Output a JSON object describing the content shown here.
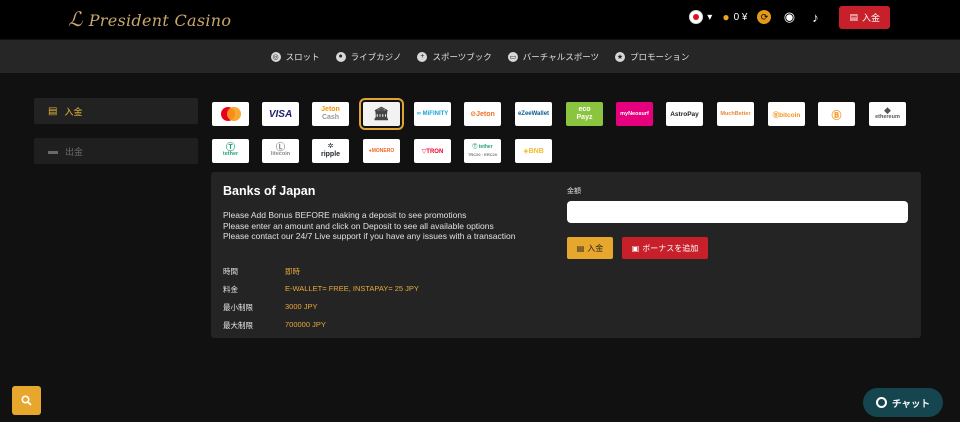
{
  "header": {
    "logo_text": "President Casino",
    "logo_mono": "ℒ",
    "balance": "0 ¥",
    "deposit_button": "入金"
  },
  "nav": {
    "items": [
      {
        "label": "スロット",
        "icon": "slot-icon"
      },
      {
        "label": "ライブカジノ",
        "icon": "live-casino-icon"
      },
      {
        "label": "スポーツブック",
        "icon": "sportsbook-icon"
      },
      {
        "label": "バーチャルスポーツ",
        "icon": "virtual-sports-icon"
      },
      {
        "label": "プロモーション",
        "icon": "promotion-icon"
      }
    ]
  },
  "sidebar": {
    "items": [
      {
        "label": "入金",
        "active": true
      },
      {
        "label": "出金",
        "active": false
      }
    ]
  },
  "payment_methods": {
    "row1": [
      "Mastercard",
      "VISA",
      "Jeton Cash",
      "Bank",
      "MiFinity",
      "Jeton",
      "eZeeWallet",
      "ecoPayz",
      "MyNeosurf",
      "AstroPay",
      "MuchBetter",
      "bitcoin",
      "Bitcoin Cash",
      "ethereum"
    ],
    "row2": [
      "tether",
      "litecoin",
      "ripple",
      "MONERO",
      "TRON",
      "tether TRC20 / ERC20",
      "BNB"
    ],
    "selected": "Bank"
  },
  "panel": {
    "title": "Banks of Japan",
    "notice": [
      "Please Add Bonus BEFORE making a deposit to see promotions",
      "Please enter an amount and click on Deposit to see all available options",
      "Please contact our 24/7 Live support if you have any issues with a transaction"
    ],
    "info": [
      {
        "key": "時間",
        "value": "即時"
      },
      {
        "key": "料金",
        "value": "E-WALLET= FREE, INSTAPAY= 25 JPY"
      },
      {
        "key": "最小制限",
        "value": "3000 JPY"
      },
      {
        "key": "最大制限",
        "value": "700000 JPY"
      }
    ],
    "amount_label": "金額",
    "amount_value": "",
    "deposit_button": "入金",
    "bonus_button": "ボーナスを追加"
  },
  "chat": {
    "label": "チャット"
  },
  "colors": {
    "accent": "#e7a72c",
    "red": "#c8202a",
    "chat": "#15454f"
  }
}
